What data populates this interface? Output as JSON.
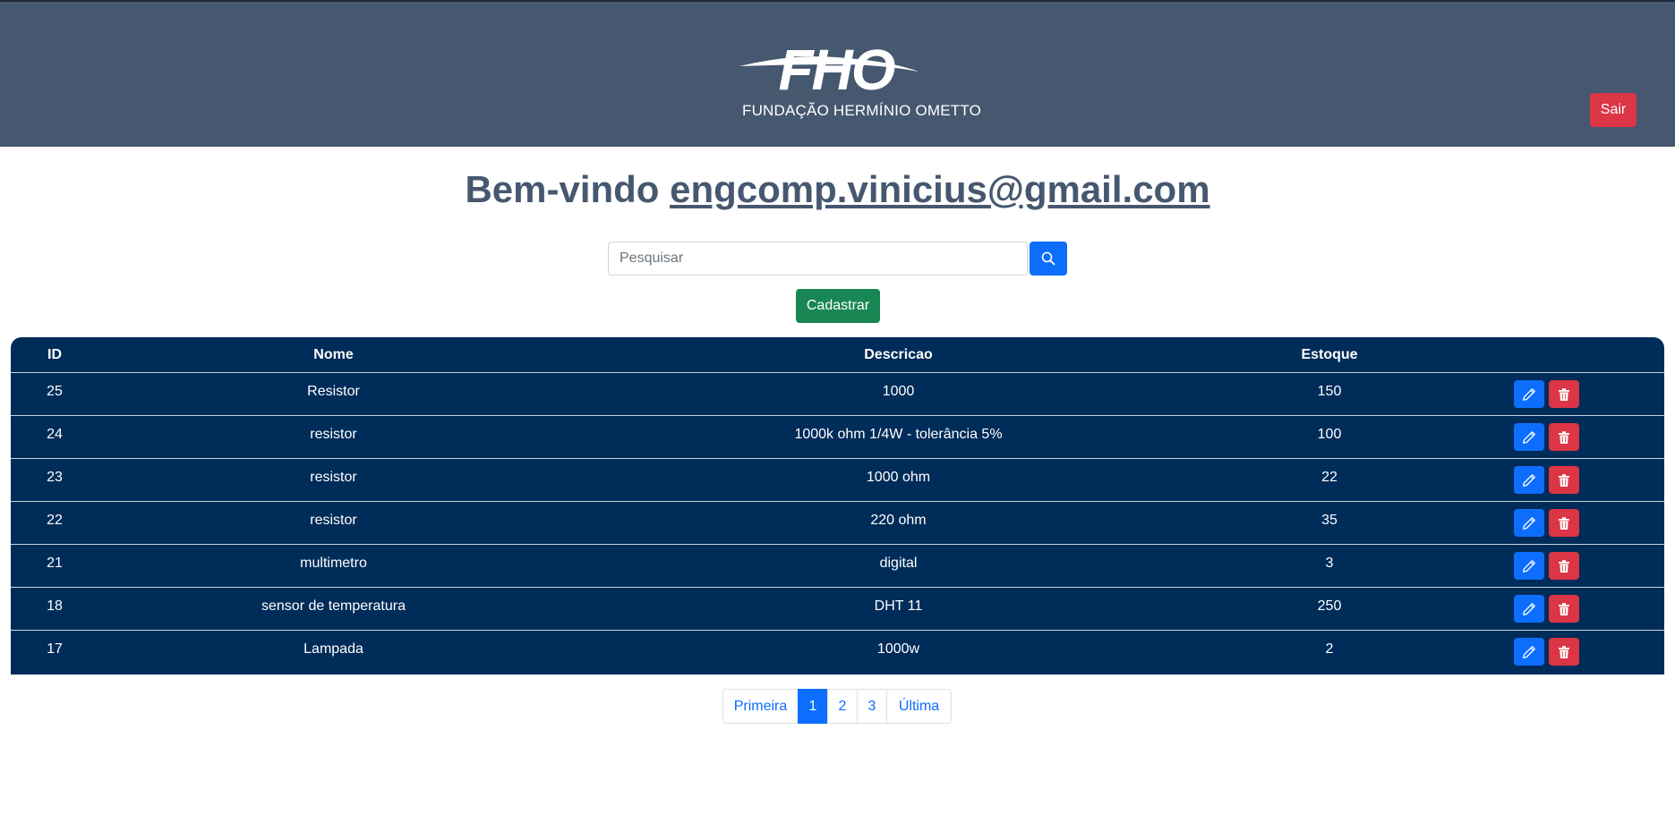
{
  "header": {
    "logo_text": "FHO",
    "logo_subtitle": "FUNDAÇÃO HERMÍNIO OMETTO",
    "logout_label": "Sair"
  },
  "welcome": {
    "prefix": "Bem-vindo",
    "email": "engcomp.vinicius@gmail.com"
  },
  "search": {
    "placeholder": "Pesquisar",
    "icon": "search-icon"
  },
  "register_label": "Cadastrar",
  "table": {
    "headers": [
      "ID",
      "Nome",
      "Descricao",
      "Estoque"
    ],
    "rows": [
      {
        "id": "25",
        "nome": "Resistor",
        "descricao": "1000",
        "estoque": "150"
      },
      {
        "id": "24",
        "nome": "resistor",
        "descricao": "1000k ohm 1/4W - tolerância 5%",
        "estoque": "100"
      },
      {
        "id": "23",
        "nome": "resistor",
        "descricao": "1000 ohm",
        "estoque": "22"
      },
      {
        "id": "22",
        "nome": "resistor",
        "descricao": "220 ohm",
        "estoque": "35"
      },
      {
        "id": "21",
        "nome": "multimetro",
        "descricao": "digital",
        "estoque": "3"
      },
      {
        "id": "18",
        "nome": "sensor de temperatura",
        "descricao": "DHT 11",
        "estoque": "250"
      },
      {
        "id": "17",
        "nome": "Lampada",
        "descricao": "1000w",
        "estoque": "2"
      }
    ],
    "row_actions": {
      "edit_icon": "pencil-icon",
      "delete_icon": "trash-icon"
    }
  },
  "pagination": {
    "first": "Primeira",
    "pages": [
      "1",
      "2",
      "3"
    ],
    "active_page": "1",
    "last": "Última"
  },
  "colors": {
    "header_bg": "#46586f",
    "table_bg": "#002c59",
    "primary": "#0d6efd",
    "danger": "#dc3545",
    "success": "#198754"
  }
}
